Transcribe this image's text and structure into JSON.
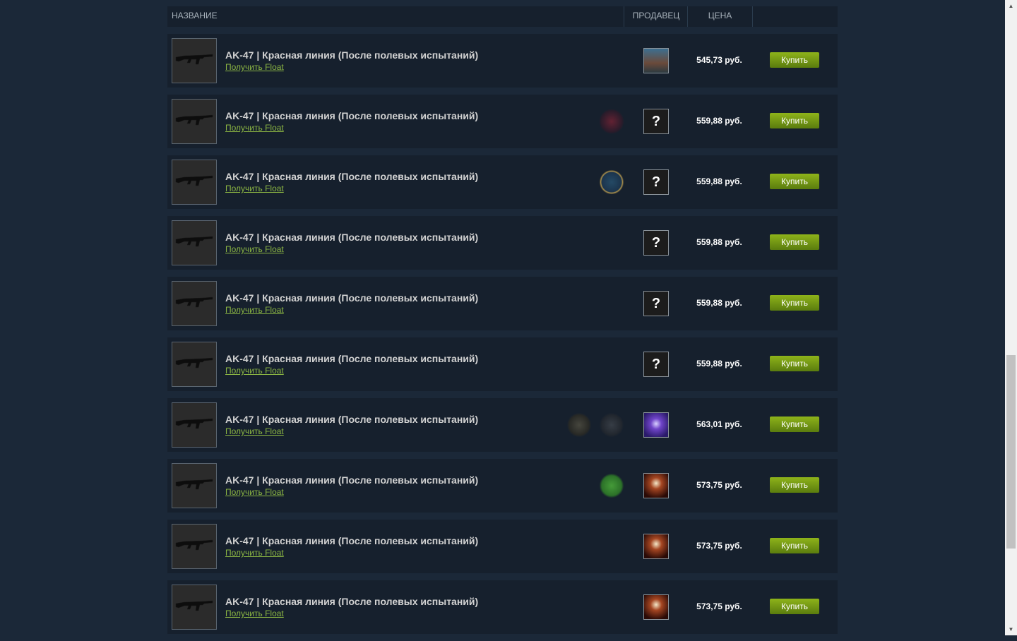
{
  "table": {
    "headers": {
      "name": "НАЗВАНИЕ",
      "seller": "ПРОДАВЕЦ",
      "price": "ЦЕНА"
    }
  },
  "rows": [
    {
      "name": "AK-47 | Красная линия (После полевых испытаний)",
      "float_link": "Получить Float",
      "price": "545,73 руб.",
      "buy": "Купить",
      "seller_avatar": "avatar-man",
      "seller_text": "",
      "stickers": []
    },
    {
      "name": "AK-47 | Красная линия (После полевых испытаний)",
      "float_link": "Получить Float",
      "price": "559,88 руб.",
      "buy": "Купить",
      "seller_avatar": "avatar-unknown",
      "seller_text": "?",
      "stickers": [
        "team-sticker-red"
      ]
    },
    {
      "name": "AK-47 | Красная линия (После полевых испытаний)",
      "float_link": "Получить Float",
      "price": "559,88 руб.",
      "buy": "Купить",
      "seller_avatar": "avatar-unknown",
      "seller_text": "?",
      "stickers": [
        "fnatic-sticker"
      ]
    },
    {
      "name": "AK-47 | Красная линия (После полевых испытаний)",
      "float_link": "Получить Float",
      "price": "559,88 руб.",
      "buy": "Купить",
      "seller_avatar": "avatar-unknown",
      "seller_text": "?",
      "stickers": []
    },
    {
      "name": "AK-47 | Красная линия (После полевых испытаний)",
      "float_link": "Получить Float",
      "price": "559,88 руб.",
      "buy": "Купить",
      "seller_avatar": "avatar-unknown",
      "seller_text": "?",
      "stickers": []
    },
    {
      "name": "AK-47 | Красная линия (После полевых испытаний)",
      "float_link": "Получить Float",
      "price": "559,88 руб.",
      "buy": "Купить",
      "seller_avatar": "avatar-unknown",
      "seller_text": "?",
      "stickers": []
    },
    {
      "name": "AK-47 | Красная линия (После полевых испытаний)",
      "float_link": "Получить Float",
      "price": "563,01 руб.",
      "buy": "Купить",
      "seller_avatar": "avatar-purple",
      "seller_text": "",
      "stickers": [
        "fnatic-sticker-gold",
        "dark-team-sticker"
      ]
    },
    {
      "name": "AK-47 | Красная линия (После полевых испытаний)",
      "float_link": "Получить Float",
      "price": "573,75 руб.",
      "buy": "Купить",
      "seller_avatar": "avatar-fire",
      "seller_text": "",
      "stickers": [
        "green-team-sticker"
      ]
    },
    {
      "name": "AK-47 | Красная линия (После полевых испытаний)",
      "float_link": "Получить Float",
      "price": "573,75 руб.",
      "buy": "Купить",
      "seller_avatar": "avatar-fire",
      "seller_text": "",
      "stickers": []
    },
    {
      "name": "AK-47 | Красная линия (После полевых испытаний)",
      "float_link": "Получить Float",
      "price": "573,75 руб.",
      "buy": "Купить",
      "seller_avatar": "avatar-fire",
      "seller_text": "",
      "stickers": []
    }
  ],
  "colors": {
    "background": "#1b2838",
    "row": "#16202d",
    "link": "#8bb543",
    "buy": "#7a9e14"
  }
}
